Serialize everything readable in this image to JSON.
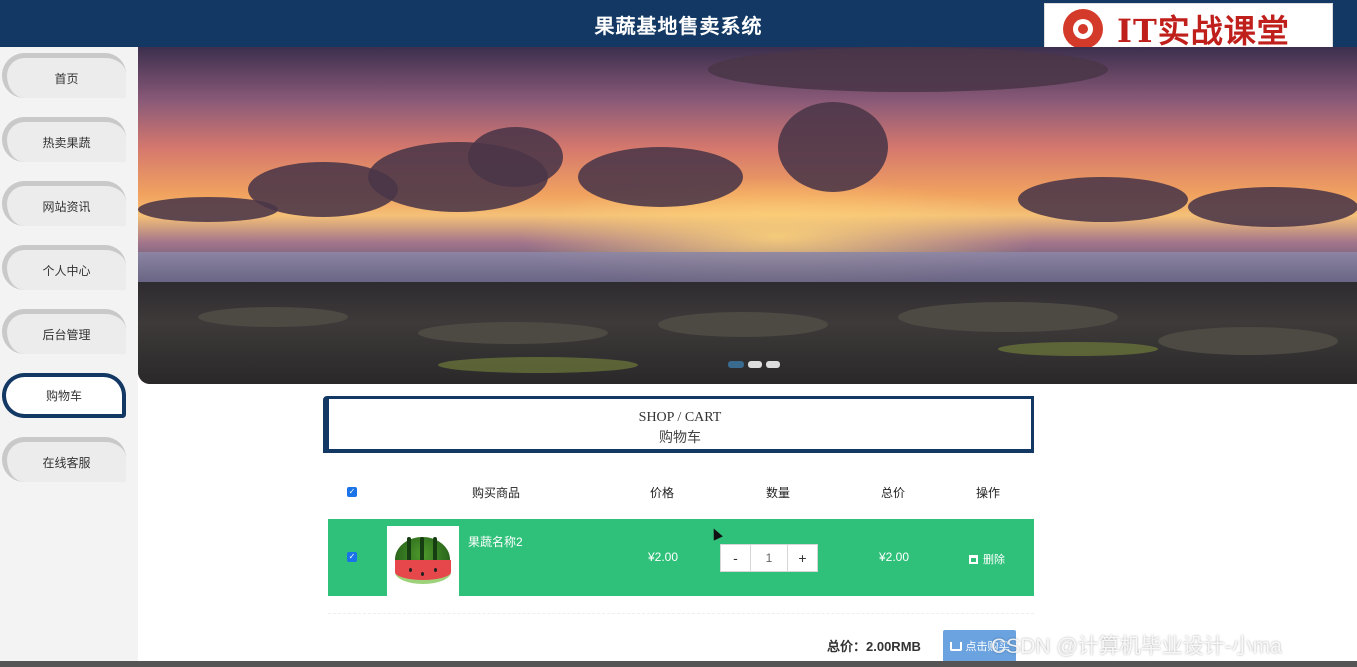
{
  "header": {
    "title": "果蔬基地售卖系统"
  },
  "logo": {
    "text": "IT实战课堂",
    "icon": "logo-icon"
  },
  "sidebar": {
    "items": [
      {
        "label": "首页"
      },
      {
        "label": "热卖果蔬"
      },
      {
        "label": "网站资讯"
      },
      {
        "label": "个人中心"
      },
      {
        "label": "后台管理"
      },
      {
        "label": "购物车",
        "active": true
      },
      {
        "label": "在线客服"
      }
    ]
  },
  "banner": {
    "slides": 3,
    "active_slide": 1
  },
  "cart": {
    "title_en": "SHOP / CART",
    "title_cn": "购物车",
    "headers": {
      "product": "购买商品",
      "price": "价格",
      "quantity": "数量",
      "total": "总价",
      "action": "操作"
    },
    "items": [
      {
        "name": "果蔬名称2",
        "price": "¥2.00",
        "quantity": "1",
        "total": "¥2.00",
        "delete_label": "删除",
        "minus_label": "-",
        "plus_label": "+",
        "checked": true
      }
    ],
    "summary": "总价：2.00RMB",
    "buy_button": "点击购买"
  },
  "watermark": "CSDN @计算机毕业设计-小ma",
  "colors": {
    "header": "#123863",
    "row": "#2fc17a",
    "buy": "#6aa3e0",
    "logo_red": "#c0201c"
  }
}
